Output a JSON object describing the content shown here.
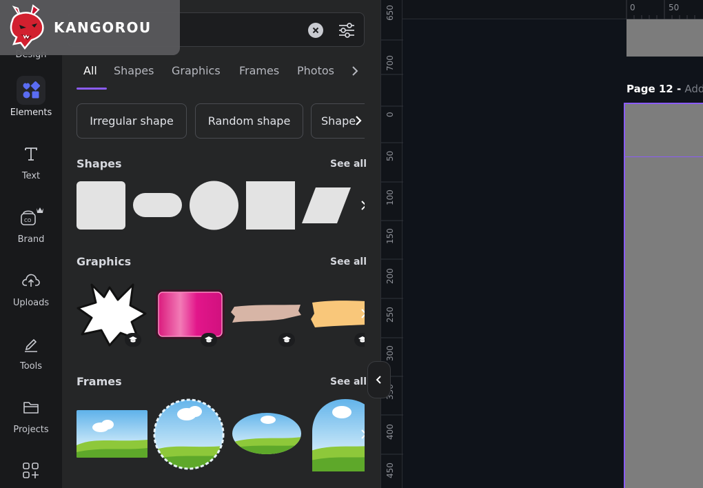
{
  "brand": {
    "name": "KANGOROU"
  },
  "rail": {
    "items": [
      {
        "label": "Design",
        "icon": "design-icon"
      },
      {
        "label": "Elements",
        "icon": "elements-icon"
      },
      {
        "label": "Text",
        "icon": "text-icon"
      },
      {
        "label": "Brand",
        "icon": "brand-icon"
      },
      {
        "label": "Uploads",
        "icon": "uploads-icon"
      },
      {
        "label": "Tools",
        "icon": "tools-icon"
      },
      {
        "label": "Projects",
        "icon": "projects-icon"
      },
      {
        "label": "",
        "icon": "apps-icon"
      }
    ],
    "active": "Elements",
    "accent": "#5a6cf2"
  },
  "search": {
    "value": "",
    "placeholder": ""
  },
  "tabs": [
    {
      "label": "All"
    },
    {
      "label": "Shapes"
    },
    {
      "label": "Graphics"
    },
    {
      "label": "Frames"
    },
    {
      "label": "Photos"
    }
  ],
  "chips": [
    {
      "label": "Irregular shape"
    },
    {
      "label": "Random shape"
    },
    {
      "label": "Shape"
    }
  ],
  "sections": {
    "shapes": {
      "title": "Shapes",
      "see_all": "See all"
    },
    "graphics": {
      "title": "Graphics",
      "see_all": "See all"
    },
    "frames": {
      "title": "Frames",
      "see_all": "See all"
    }
  },
  "canvas": {
    "page_title": "Page 12 - ",
    "page_title_add": "Add",
    "ruler_h": [
      "0",
      "50"
    ],
    "ruler_v": [
      "650",
      "700",
      "0",
      "50",
      "100",
      "150",
      "200",
      "250",
      "300",
      "350",
      "400",
      "450"
    ]
  },
  "colors": {
    "accent": "#8b5cf6",
    "panel": "#252627",
    "canvas": "#0f131a"
  }
}
